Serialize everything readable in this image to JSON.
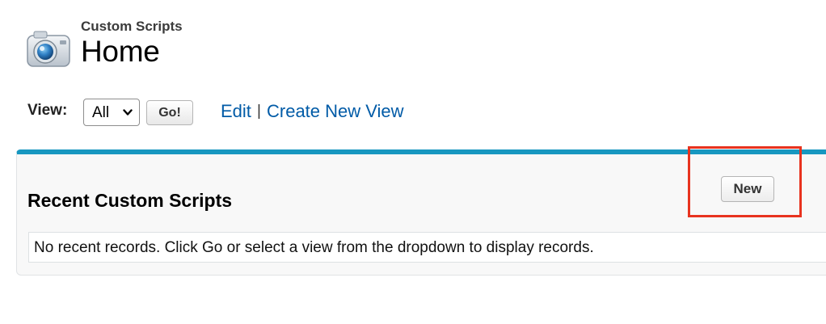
{
  "header": {
    "object_type": "Custom Scripts",
    "title": "Home",
    "icon": "camera-icon"
  },
  "view_filter": {
    "label": "View:",
    "selected": "All",
    "go_label": "Go!",
    "edit_label": "Edit",
    "separator": "|",
    "create_label": "Create New View"
  },
  "recent": {
    "title": "Recent Custom Scripts",
    "new_label": "New",
    "empty_message": "No recent records. Click Go or select a view from the dropdown to display records."
  },
  "colors": {
    "panel_accent": "#1797c0",
    "link": "#015ba7",
    "highlight": "#e8331f"
  }
}
